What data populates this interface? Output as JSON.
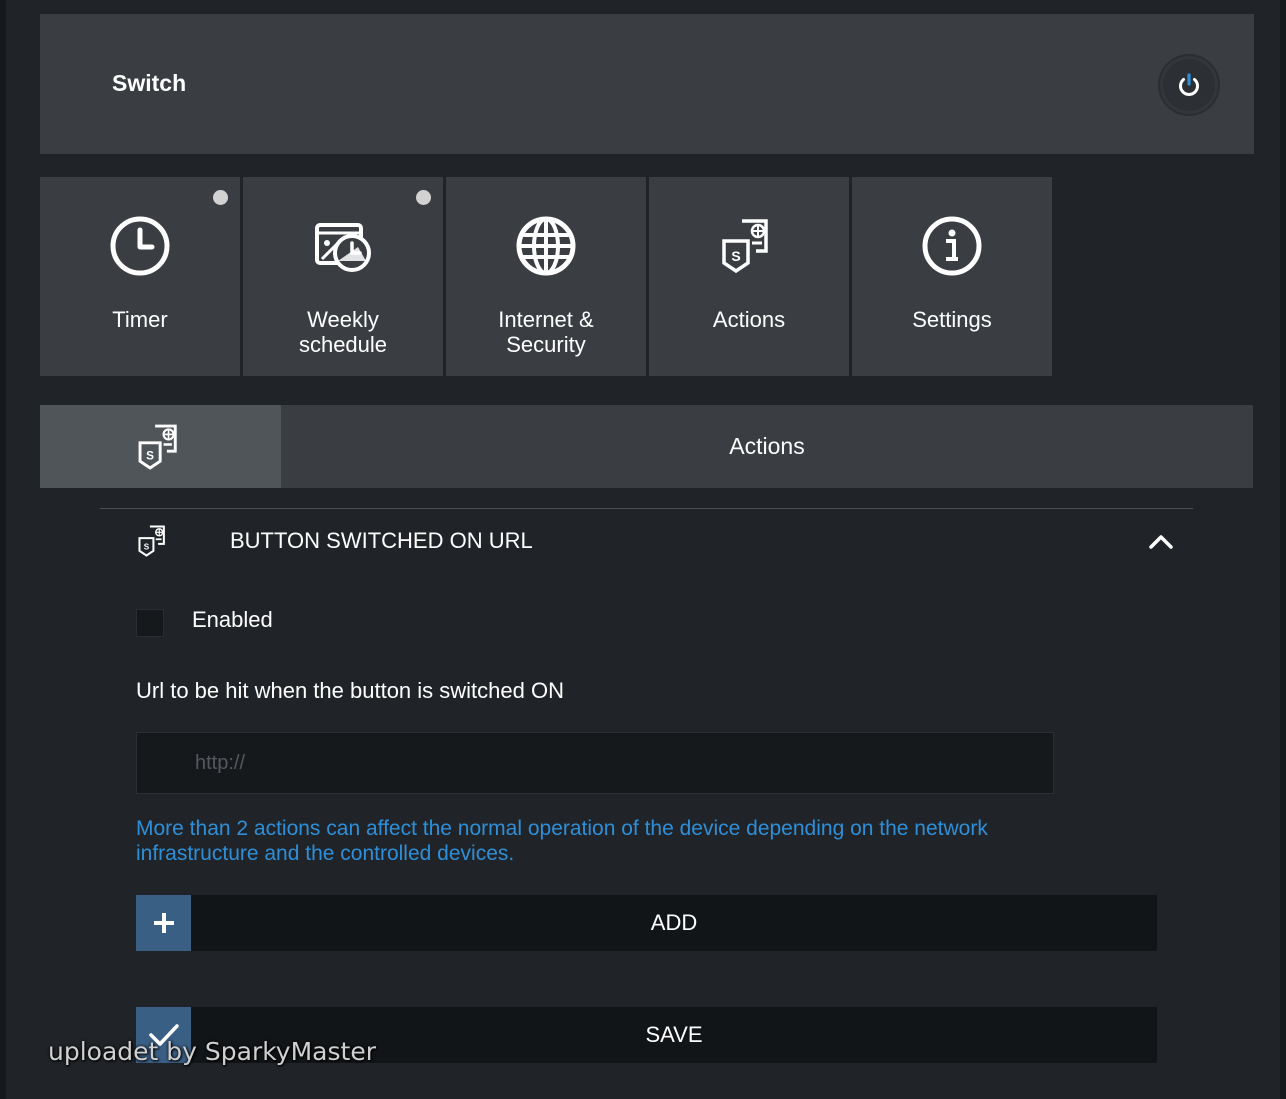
{
  "header": {
    "title": "Switch",
    "power_icon": "power-icon"
  },
  "tiles": [
    {
      "label": "Timer",
      "icon": "clock-icon",
      "indicator": true
    },
    {
      "label": "Weekly\nschedule",
      "icon": "calendar-icon",
      "indicator": true
    },
    {
      "label": "Internet &\nSecurity",
      "icon": "globe-icon",
      "indicator": false
    },
    {
      "label": "Actions",
      "icon": "actions-icon",
      "indicator": false
    },
    {
      "label": "Settings",
      "icon": "info-icon",
      "indicator": false
    }
  ],
  "section": {
    "title": "Actions",
    "icon": "actions-icon"
  },
  "panel": {
    "title": "BUTTON SWITCHED ON URL",
    "enabled_label": "Enabled",
    "enabled_checked": false,
    "url_label": "Url to be hit when the button is switched ON",
    "url_placeholder": "http://",
    "url_value": "",
    "notice": "More than 2 actions can affect the normal operation of the device depending on the network infrastructure and the controlled devices."
  },
  "buttons": {
    "add_label": "ADD",
    "save_label": "SAVE"
  },
  "watermark": "uploadet by SparkyMaster",
  "colors": {
    "page_bg": "#202428",
    "panel_bg": "#3a3e42",
    "accent": "#2e8fd8",
    "button_icon_bg": "#3a5f84"
  }
}
